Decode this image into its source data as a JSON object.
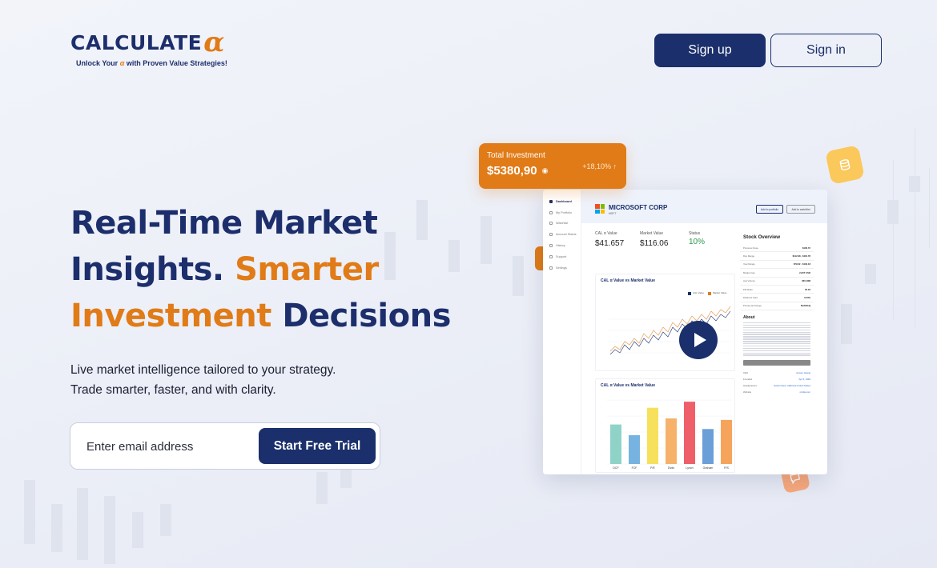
{
  "brand": {
    "name": "CALCULATE",
    "alpha": "α",
    "tagline_pre": "Unlock Your",
    "tagline_alpha": "α",
    "tagline_post": "with Proven Value Strategies!"
  },
  "nav": {
    "signup_label": "Sign up",
    "signin_label": "Sign in"
  },
  "hero": {
    "title_line1": "Real-Time Market",
    "title_line2_a": "Insights.",
    "title_line2_b": "Smarter",
    "title_line3_a": "Investment",
    "title_line3_b": "Decisions",
    "subtitle_line1": "Live market intelligence tailored to your strategy.",
    "subtitle_line2": "Trade smarter, faster, and with clarity.",
    "email_placeholder": "Enter email address",
    "cta_label": "Start Free Trial"
  },
  "investment_card": {
    "label": "Total Investment",
    "value": "$5380,90",
    "change": "+18,10% ↑"
  },
  "dashboard": {
    "sidebar": [
      "Dashboard",
      "My Portfolio",
      "Watchlist",
      "Account Status",
      "History",
      "Support",
      "Settings"
    ],
    "company": "MICROSOFT CORP",
    "ticker": "MSFT",
    "add_portfolio": "Add to portfolio",
    "add_watchlist": "Add to watchlist",
    "metrics": [
      {
        "label": "CAL α Value",
        "value": "$41.657"
      },
      {
        "label": "Market Value",
        "value": "$116.06"
      },
      {
        "label": "Status",
        "value": "10%"
      }
    ],
    "line_chart_title": "CAL α Value vs Market Value",
    "line_legend": [
      "CAL Value",
      "Market Value"
    ],
    "bar_chart_title": "CAL α Value vs Market Value",
    "bar_categories": [
      "DCF",
      "FCF",
      "P/E",
      "Dvds",
      "Lynch",
      "Graham",
      "P/S"
    ],
    "bar_values": [
      2.6,
      1.9,
      3.7,
      3.0,
      4.1,
      2.3,
      2.9
    ],
    "bar_colors": [
      "#8fd3c8",
      "#76b3e0",
      "#f7e15c",
      "#f6b26b",
      "#ef5f6a",
      "#6a9fd8",
      "#f6a45c"
    ],
    "overview_title": "Stock Overview",
    "overview_rows": [
      [
        "Previous Close",
        "$106.72"
      ],
      [
        "Day Range",
        "$112.98 - $116.78"
      ],
      [
        "Year Range",
        "$79.62 - $133.18"
      ],
      [
        "Market Cap",
        "2,84T USD"
      ],
      [
        "Avg Volume",
        "360.18M"
      ],
      [
        "P/E Ratio",
        "35.02"
      ],
      [
        "Dividend Yield",
        "0.03%"
      ],
      [
        "Primary Exchange",
        "NASDAQ"
      ]
    ],
    "about_title": "About",
    "show_more": "Show More",
    "info_rows": [
      [
        "CEO",
        "Jensen Huang"
      ],
      [
        "Founded",
        "Apr 5, 1993"
      ],
      [
        "Headquarters",
        "Santa Clara, California United States"
      ],
      [
        "Website",
        "nvidia.com"
      ]
    ]
  },
  "colors": {
    "navy": "#1a2f6b",
    "orange": "#e07b17"
  }
}
